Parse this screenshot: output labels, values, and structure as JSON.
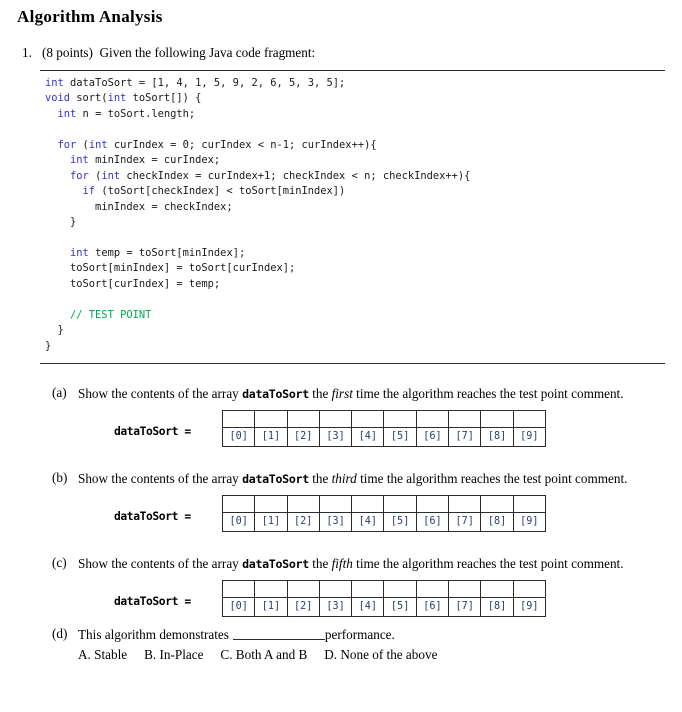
{
  "document": {
    "title": "Algorithm Analysis"
  },
  "problem": {
    "number": "1.",
    "points": "(8 points)",
    "prompt": "Given the following Java code fragment:"
  },
  "code": {
    "language": "java",
    "keyword_color": "#3333cc",
    "comment_color": "#00a851",
    "lines": [
      "int dataToSort = [1, 4, 1, 5, 9, 2, 6, 5, 3, 5];",
      "void sort(int toSort[]) {",
      "  int n = toSort.length;",
      "",
      "  for (int curIndex = 0; curIndex < n-1; curIndex++){",
      "    int minIndex = curIndex;",
      "    for (int checkIndex = curIndex+1; checkIndex < n; checkIndex++){",
      "      if (toSort[checkIndex] < toSort[minIndex])",
      "        minIndex = checkIndex;",
      "    }",
      "",
      "    int temp = toSort[minIndex];",
      "    toSort[minIndex] = toSort[curIndex];",
      "    toSort[curIndex] = temp;",
      "",
      "    // TEST POINT",
      "  }",
      "}"
    ],
    "array_literal": [
      1,
      4,
      1,
      5,
      9,
      2,
      6,
      5,
      3,
      5
    ],
    "test_point_comment": "// TEST POINT"
  },
  "parts": [
    {
      "label": "(a)",
      "text_before": "Show the contents of the array ",
      "array_var": "dataToSort",
      "text_mid": " the ",
      "ordinal": "first",
      "text_after": " time the algorithm reaches the test point comment.",
      "array_label": "dataToSort =",
      "indices": [
        "[0]",
        "[1]",
        "[2]",
        "[3]",
        "[4]",
        "[5]",
        "[6]",
        "[7]",
        "[8]",
        "[9]"
      ],
      "values": [
        "",
        "",
        "",
        "",
        "",
        "",
        "",
        "",
        "",
        ""
      ]
    },
    {
      "label": "(b)",
      "text_before": "Show the contents of the array ",
      "array_var": "dataToSort",
      "text_mid": " the ",
      "ordinal": "third",
      "text_after": " time the algorithm reaches the test point comment.",
      "array_label": "dataToSort =",
      "indices": [
        "[0]",
        "[1]",
        "[2]",
        "[3]",
        "[4]",
        "[5]",
        "[6]",
        "[7]",
        "[8]",
        "[9]"
      ],
      "values": [
        "",
        "",
        "",
        "",
        "",
        "",
        "",
        "",
        "",
        ""
      ]
    },
    {
      "label": "(c)",
      "text_before": "Show the contents of the array ",
      "array_var": "dataToSort",
      "text_mid": " the ",
      "ordinal": "fifth",
      "text_after": " time the algorithm reaches the test point comment.",
      "array_label": "dataToSort =",
      "indices": [
        "[0]",
        "[1]",
        "[2]",
        "[3]",
        "[4]",
        "[5]",
        "[6]",
        "[7]",
        "[8]",
        "[9]"
      ],
      "values": [
        "",
        "",
        "",
        "",
        "",
        "",
        "",
        "",
        "",
        ""
      ]
    }
  ],
  "part_d": {
    "label": "(d)",
    "text_before": "This algorithm demonstrates",
    "text_after": "performance.",
    "choices": [
      "A.  Stable",
      "B.  In-Place",
      "C.  Both A and B",
      "D.  None of the above"
    ]
  }
}
